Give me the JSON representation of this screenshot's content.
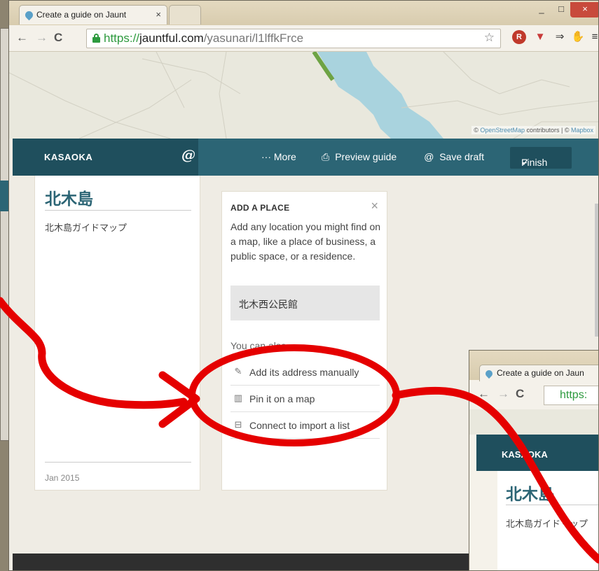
{
  "browser": {
    "tab_title": "Create a guide on Jaunt",
    "url_scheme": "https://",
    "url_host": "jauntful.com",
    "url_path": "/yasunari/l1lffkFrce",
    "window_buttons": {
      "minimize": "_",
      "maximize": "□",
      "close": "×"
    },
    "tab_close": "×"
  },
  "map": {
    "attribution_prefix": "© ",
    "attribution_osm": "OpenStreetMap",
    "attribution_mid": " contributors | © ",
    "attribution_mapbox": "Mapbox"
  },
  "appbar": {
    "brand": "KASAOKA",
    "more_label": "··· More",
    "preview_label": "Preview guide",
    "save_label": "Save draft",
    "finish_label": "Finish"
  },
  "guide": {
    "title": "北木島",
    "subtitle": "北木島ガイドマップ",
    "date": "Jan 2015"
  },
  "add_place": {
    "heading": "ADD A PLACE",
    "close": "×",
    "description": "Add any location you might find on a map, like a place of business, a public space, or a residence.",
    "search_value": "北木西公民館",
    "also_label": "You can also",
    "options": [
      {
        "label": "Add its address manually",
        "icon": "pencil-icon"
      },
      {
        "label": "Pin it on a map",
        "icon": "map-icon"
      },
      {
        "label": "Connect to import a list",
        "icon": "bookmark-icon"
      }
    ]
  },
  "mini_browser": {
    "tab_title": "Create a guide on Jaun",
    "url_fragment": "https:",
    "brand": "KASAOKA",
    "guide_title": "北木島",
    "guide_subtitle": "北木島ガイドマップ"
  },
  "colors": {
    "appbar": "#2c6575",
    "appbar_dark": "#1f4f5d",
    "annotation": "#e50000",
    "lock_green": "#2d9a3e"
  }
}
